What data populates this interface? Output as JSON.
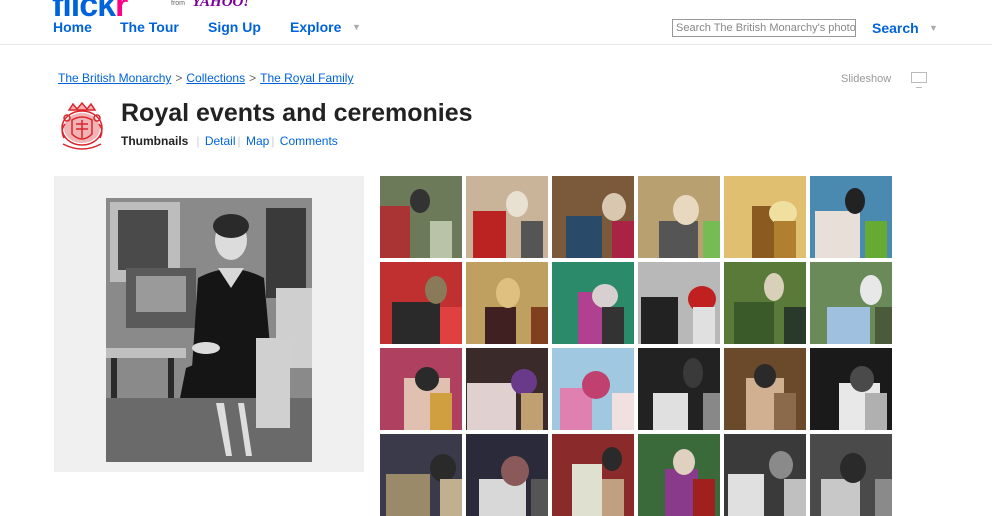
{
  "header": {
    "logo_part1": "flick",
    "logo_part2": "r",
    "from_label": "from",
    "yahoo_label": "YAHOO!",
    "nav": [
      {
        "label": "Home"
      },
      {
        "label": "The Tour"
      },
      {
        "label": "Sign Up"
      },
      {
        "label": "Explore"
      }
    ],
    "search_placeholder": "Search The British Monarchy's photos",
    "search_button": "Search"
  },
  "breadcrumb": {
    "items": [
      "The British Monarchy",
      "Collections",
      "The Royal Family"
    ],
    "separator": ">"
  },
  "slideshow_label": "Slideshow",
  "set": {
    "title": "Royal events and ceremonies",
    "views": {
      "active": "Thumbnails",
      "links": [
        "Detail",
        "Map",
        "Comments"
      ]
    }
  },
  "colors": {
    "link": "#0063dc",
    "flickr_pink": "#ff0084",
    "yahoo_purple": "#7b0099",
    "crest_red": "#d9262c"
  },
  "icons": [
    "royal-crest-icon",
    "slideshow-icon",
    "dropdown-arrow-icon"
  ],
  "thumbnails": {
    "rows": 4,
    "columns": 6,
    "count": 24
  }
}
